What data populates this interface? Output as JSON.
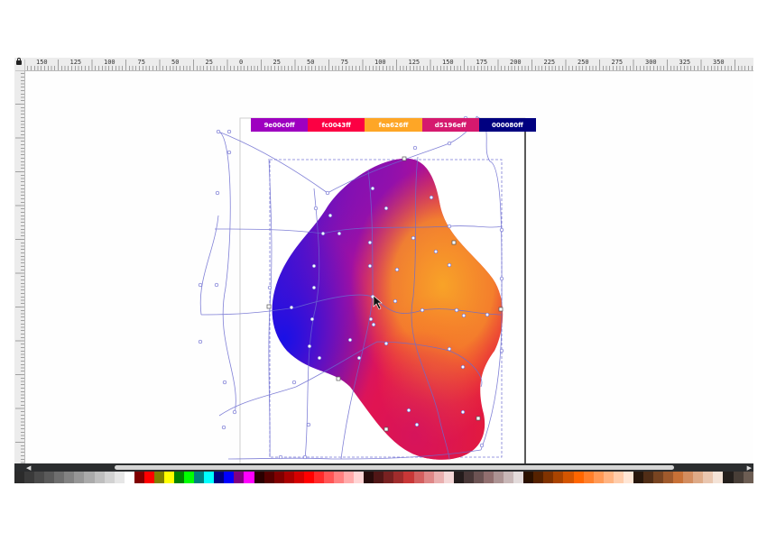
{
  "ruler": {
    "labels": [
      "150",
      "125",
      "100",
      "75",
      "50",
      "25",
      "0",
      "25",
      "50",
      "75",
      "100",
      "125",
      "150",
      "175",
      "200",
      "225",
      "250",
      "275",
      "300",
      "325",
      "350"
    ]
  },
  "gradient_stops": [
    {
      "label": "9e00c0ff",
      "color": "#9e00c0"
    },
    {
      "label": "fc0043ff",
      "color": "#fc0043"
    },
    {
      "label": "fea626ff",
      "color": "#fea626"
    },
    {
      "label": "d5196eff",
      "color": "#d5196e"
    },
    {
      "label": "000080ff",
      "color": "#000080"
    }
  ],
  "palette": {
    "colors": [
      "#2b2b2b",
      "#3a3a3a",
      "#4a4a4a",
      "#5a5a5a",
      "#6e6e6e",
      "#828282",
      "#969696",
      "#aaaaaa",
      "#bebebe",
      "#d2d2d2",
      "#e6e6e6",
      "#ffffff",
      "#800000",
      "#ff0000",
      "#808000",
      "#ffff00",
      "#008000",
      "#00ff00",
      "#008080",
      "#00ffff",
      "#000080",
      "#0000ff",
      "#800080",
      "#ff00ff",
      "#2a0000",
      "#550000",
      "#800000",
      "#aa0000",
      "#d40000",
      "#ff0000",
      "#ff2a2a",
      "#ff5555",
      "#ff8080",
      "#ffaaaa",
      "#ffd5d5",
      "#280b0b",
      "#501616",
      "#782121",
      "#a02c2c",
      "#c83737",
      "#d35f5f",
      "#de8787",
      "#e9afaf",
      "#f4d7d7",
      "#241c1c",
      "#483737",
      "#6c5353",
      "#916f6f",
      "#ac9393",
      "#c8b7b7",
      "#e3dbdb",
      "#2b1100",
      "#552200",
      "#803300",
      "#aa4400",
      "#d45500",
      "#ff6600",
      "#ff7f2a",
      "#ff9955",
      "#ffb380",
      "#ffccaa",
      "#ffe6d5",
      "#28170b",
      "#502d16",
      "#784421",
      "#a05a2c",
      "#c87137",
      "#d38d5f",
      "#deaa87",
      "#e9c6af",
      "#f4e3d7",
      "#241f1c",
      "#483e37",
      "#6c5d53"
    ]
  }
}
